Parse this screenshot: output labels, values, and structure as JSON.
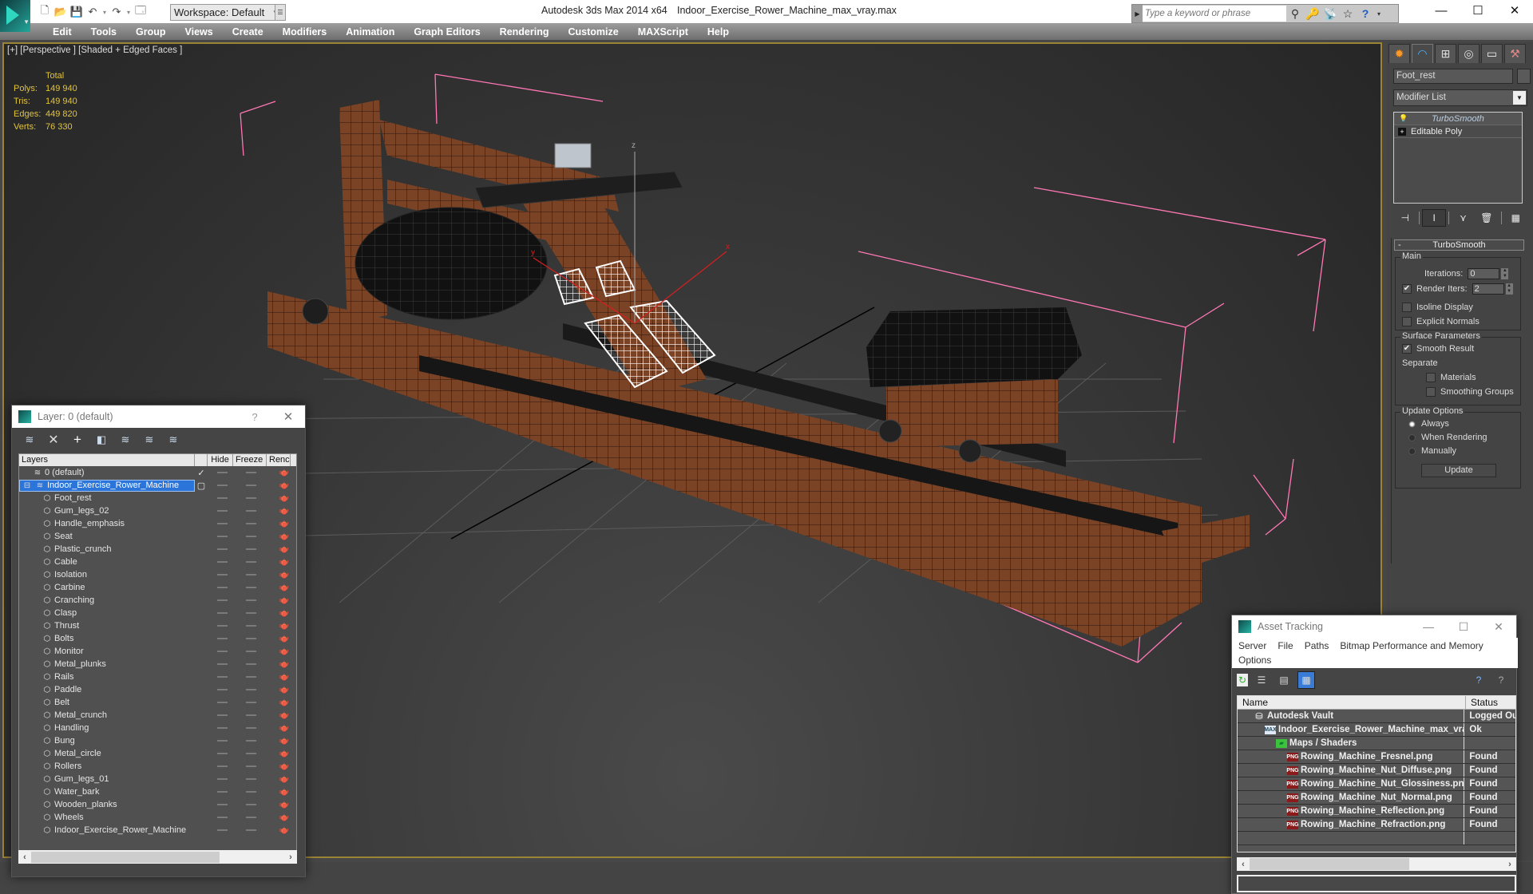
{
  "app": {
    "title": "Autodesk 3ds Max  2014 x64",
    "file": "Indoor_Exercise_Rower_Machine_max_vray.max",
    "workspace": "Workspace: Default",
    "search_placeholder": "Type a keyword or phrase"
  },
  "menu": [
    "Edit",
    "Tools",
    "Group",
    "Views",
    "Create",
    "Modifiers",
    "Animation",
    "Graph Editors",
    "Rendering",
    "Customize",
    "MAXScript",
    "Help"
  ],
  "viewport": {
    "label": "[+] [Perspective ] [Shaded + Edged Faces ]",
    "stats": {
      "header": "Total",
      "rows": [
        {
          "key": "Polys:",
          "value": "149 940"
        },
        {
          "key": "Tris:",
          "value": "149 940"
        },
        {
          "key": "Edges:",
          "value": "449 820"
        },
        {
          "key": "Verts:",
          "value": "76 330"
        }
      ]
    },
    "axes": {
      "x": "x",
      "y": "y",
      "z": "z"
    }
  },
  "command_panel": {
    "object_name": "Foot_rest",
    "modifier_list": "Modifier List",
    "stack": [
      {
        "label": "TurboSmooth",
        "icon": "lightbulb-icon"
      },
      {
        "label": "Editable Poly",
        "icon": "plus-box-icon"
      }
    ],
    "rollout": {
      "title": "TurboSmooth",
      "collapse": "-",
      "main_group": "Main",
      "iterations_label": "Iterations:",
      "iterations_value": "0",
      "render_iters_label": "Render Iters:",
      "render_iters_value": "2",
      "render_iters_checked": true,
      "isoline_label": "Isoline Display",
      "isoline_checked": false,
      "explicit_label": "Explicit Normals",
      "explicit_checked": false,
      "surface_group": "Surface Parameters",
      "smooth_result_label": "Smooth Result",
      "smooth_result_checked": true,
      "separate_label": "Separate",
      "materials_label": "Materials",
      "smoothing_groups_label": "Smoothing Groups",
      "update_group": "Update Options",
      "always_label": "Always",
      "when_rendering_label": "When Rendering",
      "manually_label": "Manually",
      "selected_update": "Always",
      "update_button": "Update"
    }
  },
  "layer_dialog": {
    "title": "Layer: 0 (default)",
    "help": "?",
    "columns": {
      "name": "Layers",
      "hide": "Hide",
      "freeze": "Freeze",
      "render": "Renc"
    },
    "layers": [
      {
        "name": "0 (default)",
        "level": 0,
        "current": true
      },
      {
        "name": "Indoor_Exercise_Rower_Machine",
        "level": 0,
        "selected": true,
        "expanded": true
      },
      {
        "name": "Foot_rest",
        "level": 1
      },
      {
        "name": "Gum_legs_02",
        "level": 1
      },
      {
        "name": "Handle_emphasis",
        "level": 1
      },
      {
        "name": "Seat",
        "level": 1
      },
      {
        "name": "Plastic_crunch",
        "level": 1
      },
      {
        "name": "Cable",
        "level": 1
      },
      {
        "name": "Isolation",
        "level": 1
      },
      {
        "name": "Carbine",
        "level": 1
      },
      {
        "name": "Cranching",
        "level": 1
      },
      {
        "name": "Clasp",
        "level": 1
      },
      {
        "name": "Thrust",
        "level": 1
      },
      {
        "name": "Bolts",
        "level": 1
      },
      {
        "name": "Monitor",
        "level": 1
      },
      {
        "name": "Metal_plunks",
        "level": 1
      },
      {
        "name": "Rails",
        "level": 1
      },
      {
        "name": "Paddle",
        "level": 1
      },
      {
        "name": "Belt",
        "level": 1
      },
      {
        "name": "Metal_crunch",
        "level": 1
      },
      {
        "name": "Handling",
        "level": 1
      },
      {
        "name": "Bung",
        "level": 1
      },
      {
        "name": "Metal_circle",
        "level": 1
      },
      {
        "name": "Rollers",
        "level": 1
      },
      {
        "name": "Gum_legs_01",
        "level": 1
      },
      {
        "name": "Water_bark",
        "level": 1
      },
      {
        "name": "Wooden_planks",
        "level": 1
      },
      {
        "name": "Wheels",
        "level": 1
      },
      {
        "name": "Indoor_Exercise_Rower_Machine",
        "level": 1
      }
    ]
  },
  "asset_tracking": {
    "title": "Asset Tracking",
    "menus": [
      "Server",
      "File",
      "Paths",
      "Bitmap Performance and Memory",
      "Options"
    ],
    "columns": {
      "name": "Name",
      "status": "Status"
    },
    "rows": [
      {
        "name": "Autodesk Vault",
        "status": "Logged Out",
        "level": 0,
        "icon": "vault"
      },
      {
        "name": "Indoor_Exercise_Rower_Machine_max_vra...",
        "status": "Ok",
        "level": 1,
        "icon": "max"
      },
      {
        "name": "Maps / Shaders",
        "status": "",
        "level": 2,
        "icon": "maps"
      },
      {
        "name": "Rowing_Machine_Fresnel.png",
        "status": "Found",
        "level": 3,
        "icon": "png"
      },
      {
        "name": "Rowing_Machine_Nut_Diffuse.png",
        "status": "Found",
        "level": 3,
        "icon": "png"
      },
      {
        "name": "Rowing_Machine_Nut_Glossiness.png",
        "status": "Found",
        "level": 3,
        "icon": "png"
      },
      {
        "name": "Rowing_Machine_Nut_Normal.png",
        "status": "Found",
        "level": 3,
        "icon": "png"
      },
      {
        "name": "Rowing_Machine_Reflection.png",
        "status": "Found",
        "level": 3,
        "icon": "png"
      },
      {
        "name": "Rowing_Machine_Refraction.png",
        "status": "Found",
        "level": 3,
        "icon": "png"
      }
    ]
  },
  "colors": {
    "viewport_border": "#9c8436",
    "stats_text": "#e3c439",
    "selection_bbox": "#ff77b4",
    "selection_blue": "#2b74d9",
    "wood": "#7a4326"
  }
}
